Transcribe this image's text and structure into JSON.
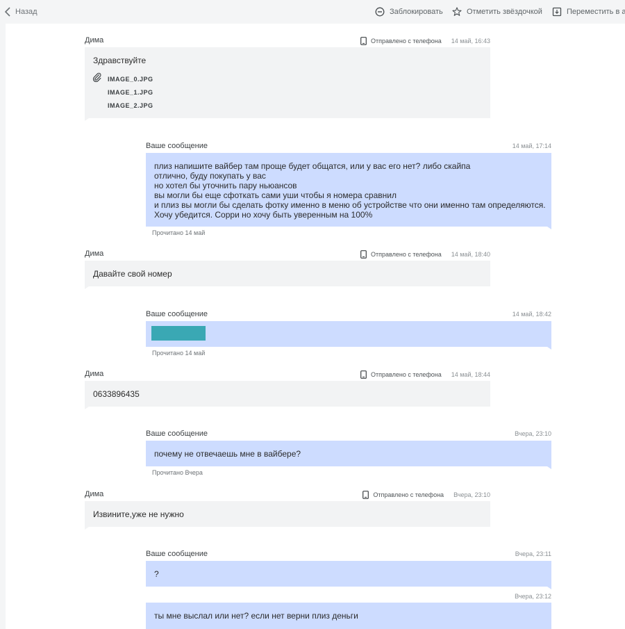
{
  "toolbar": {
    "back_label": "Назад",
    "block_label": "Заблокировать",
    "star_label": "Отметить звёздочкой",
    "archive_label": "Переместить в архив"
  },
  "messages": [
    {
      "author": "Дима",
      "source": "Отправлено с телефона",
      "time": "14 май, 16:43",
      "text": "Здравствуйте",
      "attachments": [
        "IMAGE_0.JPG",
        "IMAGE_1.JPG",
        "IMAGE_2.JPG"
      ]
    },
    {
      "author": "Ваше сообщение",
      "time": "14 май, 17:14",
      "lines": [
        "плиз напишите вайбер там проще будет общатся, или у вас его нет? либо скайпа",
        "отлично, буду покупать у вас",
        "но хотел бы уточнить пару ньюансов",
        "вы могли бы еще сфоткать сами уши чтобы я номера сравнил",
        "и плиз вы могли бы сделать фотку именно в меню об устройстве что они именно там определяются.",
        "Хочу убедится. Сорри но хочу быть уверенным на 100%"
      ],
      "read": "Прочитано 14 май"
    },
    {
      "author": "Дима",
      "source": "Отправлено с телефона",
      "time": "14 май, 18:40",
      "text": "Давайте свой номер"
    },
    {
      "author": "Ваше сообщение",
      "time": "14 май, 18:42",
      "read": "Прочитано 14 май"
    },
    {
      "author": "Дима",
      "source": "Отправлено с телефона",
      "time": "14 май, 18:44",
      "text": "0633896435"
    },
    {
      "author": "Ваше сообщение",
      "time": "Вчера, 23:10",
      "text": "почему не отвечаешь мне в вайбере?",
      "read": "Прочитано Вчера"
    },
    {
      "author": "Дима",
      "source": "Отправлено с телефона",
      "time": "Вчера, 23:10",
      "text": "Извините,уже не нужно"
    },
    {
      "author": "Ваше сообщение",
      "time": "Вчера, 23:11",
      "text": "?"
    },
    {
      "time": "Вчера, 23:12",
      "text": "ты мне выслал или нет? если нет верни плиз деньги"
    }
  ]
}
